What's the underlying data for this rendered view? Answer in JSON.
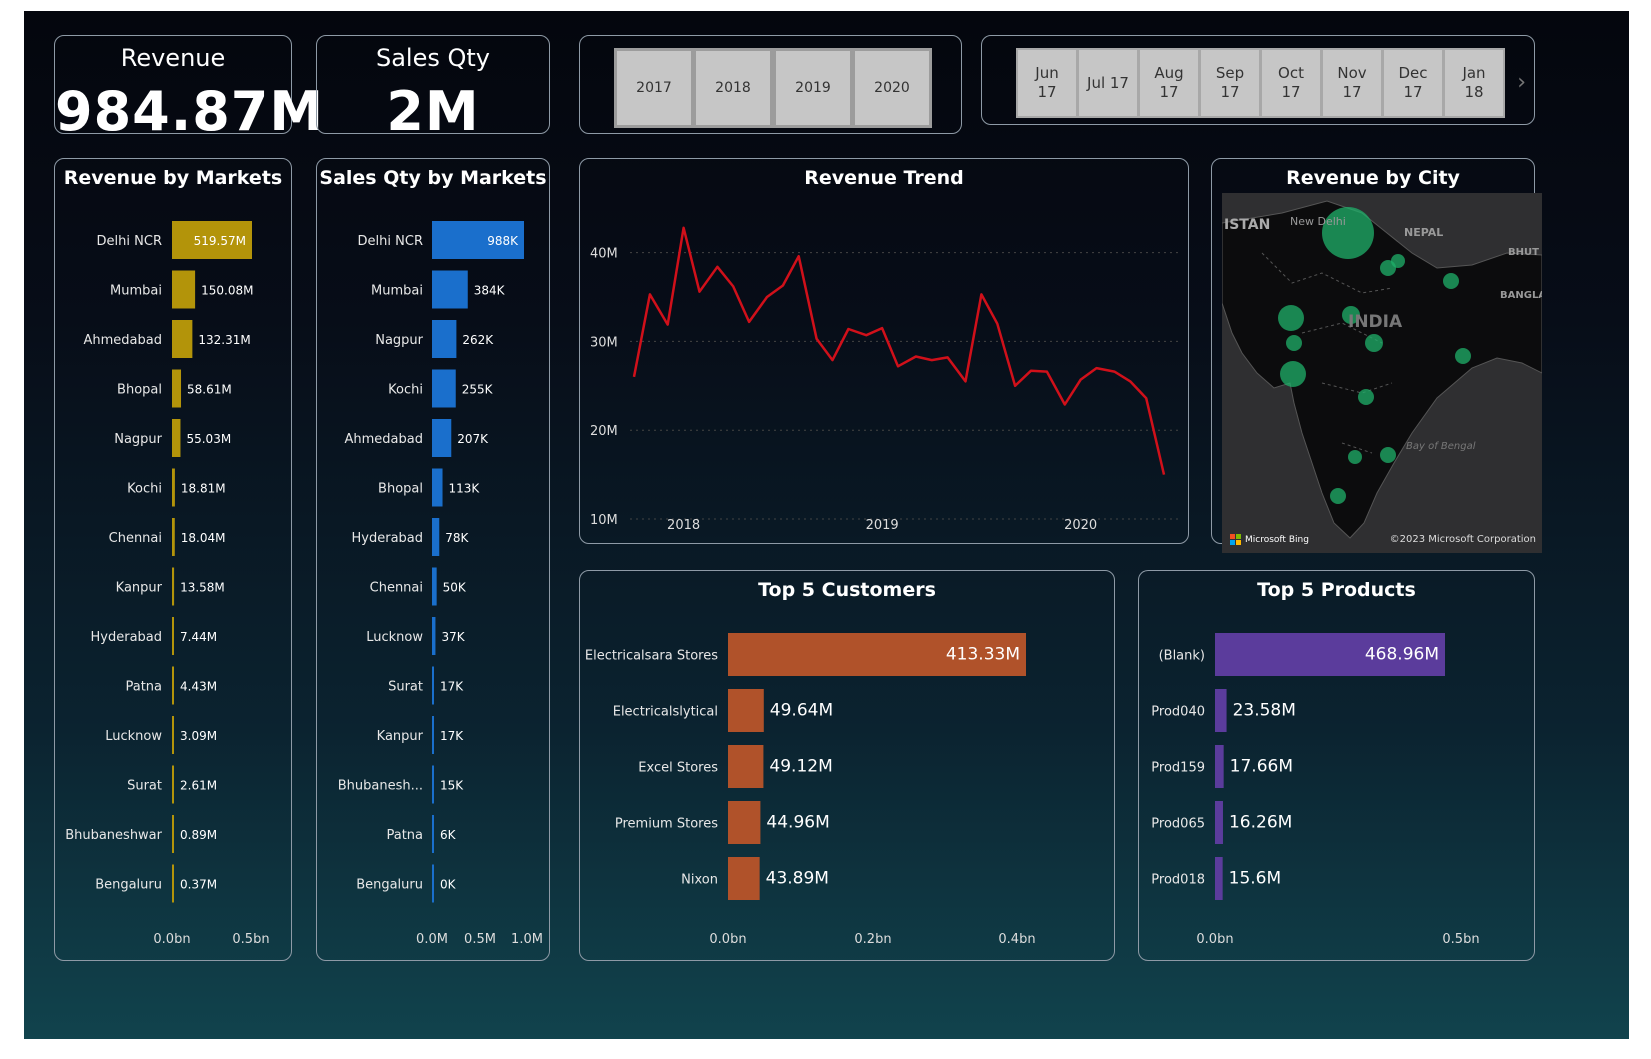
{
  "kpis": {
    "revenue": {
      "title": "Revenue",
      "value": "984.87M"
    },
    "sales_qty": {
      "title": "Sales Qty",
      "value": "2M"
    }
  },
  "years": [
    "2017",
    "2018",
    "2019",
    "2020"
  ],
  "months": [
    "Jun\n17",
    "Jul 17",
    "Aug\n17",
    "Sep\n17",
    "Oct\n17",
    "Nov\n17",
    "Dec\n17",
    "Jan\n18"
  ],
  "revenue_by_markets": {
    "title": "Revenue by Markets",
    "color": "#b3940a",
    "axis_ticks": [
      "0.0bn",
      "0.5bn"
    ],
    "items": [
      {
        "label": "Delhi NCR",
        "value": 519.57,
        "text": "519.57M"
      },
      {
        "label": "Mumbai",
        "value": 150.08,
        "text": "150.08M"
      },
      {
        "label": "Ahmedabad",
        "value": 132.31,
        "text": "132.31M"
      },
      {
        "label": "Bhopal",
        "value": 58.61,
        "text": "58.61M"
      },
      {
        "label": "Nagpur",
        "value": 55.03,
        "text": "55.03M"
      },
      {
        "label": "Kochi",
        "value": 18.81,
        "text": "18.81M"
      },
      {
        "label": "Chennai",
        "value": 18.04,
        "text": "18.04M"
      },
      {
        "label": "Kanpur",
        "value": 13.58,
        "text": "13.58M"
      },
      {
        "label": "Hyderabad",
        "value": 7.44,
        "text": "7.44M"
      },
      {
        "label": "Patna",
        "value": 4.43,
        "text": "4.43M"
      },
      {
        "label": "Lucknow",
        "value": 3.09,
        "text": "3.09M"
      },
      {
        "label": "Surat",
        "value": 2.61,
        "text": "2.61M"
      },
      {
        "label": "Bhubaneshwar",
        "value": 0.89,
        "text": "0.89M"
      },
      {
        "label": "Bengaluru",
        "value": 0.37,
        "text": "0.37M"
      }
    ]
  },
  "sales_qty_by_markets": {
    "title": "Sales Qty by Markets",
    "color": "#1a6fcc",
    "axis_ticks": [
      "0.0M",
      "0.5M",
      "1.0M"
    ],
    "items": [
      {
        "label": "Delhi NCR",
        "value": 988,
        "text": "988K"
      },
      {
        "label": "Mumbai",
        "value": 384,
        "text": "384K"
      },
      {
        "label": "Nagpur",
        "value": 262,
        "text": "262K"
      },
      {
        "label": "Kochi",
        "value": 255,
        "text": "255K"
      },
      {
        "label": "Ahmedabad",
        "value": 207,
        "text": "207K"
      },
      {
        "label": "Bhopal",
        "value": 113,
        "text": "113K"
      },
      {
        "label": "Hyderabad",
        "value": 78,
        "text": "78K"
      },
      {
        "label": "Chennai",
        "value": 50,
        "text": "50K"
      },
      {
        "label": "Lucknow",
        "value": 37,
        "text": "37K"
      },
      {
        "label": "Surat",
        "value": 17,
        "text": "17K"
      },
      {
        "label": "Kanpur",
        "value": 17,
        "text": "17K"
      },
      {
        "label": "Bhubanesh...",
        "value": 15,
        "text": "15K"
      },
      {
        "label": "Patna",
        "value": 6,
        "text": "6K"
      },
      {
        "label": "Bengaluru",
        "value": 0,
        "text": "0K"
      }
    ]
  },
  "revenue_trend": {
    "title": "Revenue Trend",
    "color": "#d0101a",
    "y_ticks": [
      {
        "v": 40,
        "label": "40M"
      },
      {
        "v": 30,
        "label": "30M"
      },
      {
        "v": 20,
        "label": "20M"
      },
      {
        "v": 10,
        "label": "10M"
      }
    ],
    "x_ticks": [
      {
        "v": 2018.0,
        "label": "2018"
      },
      {
        "v": 2019.0,
        "label": "2019"
      },
      {
        "v": 2020.0,
        "label": "2020"
      }
    ]
  },
  "chart_data": {
    "type": "line",
    "title": "Revenue Trend",
    "x": [
      2017.75,
      2017.83,
      2017.92,
      2018.0,
      2018.08,
      2018.17,
      2018.25,
      2018.33,
      2018.42,
      2018.5,
      2018.58,
      2018.67,
      2018.75,
      2018.83,
      2018.92,
      2019.0,
      2019.08,
      2019.17,
      2019.25,
      2019.33,
      2019.42,
      2019.5,
      2019.58,
      2019.67,
      2019.75,
      2019.83,
      2019.92,
      2020.0,
      2020.08,
      2020.17,
      2020.25,
      2020.33,
      2020.42
    ],
    "series": [
      {
        "values": [
          26.0,
          35.3,
          31.9,
          42.8,
          35.6,
          38.4,
          36.2,
          32.2,
          35.0,
          36.3,
          39.6,
          30.3,
          27.9,
          31.4,
          30.7,
          31.5,
          27.2,
          28.3,
          27.9,
          28.2,
          25.5,
          35.3,
          32.0,
          25.0,
          26.7,
          26.6,
          22.9,
          25.7,
          27.0,
          26.6,
          25.5,
          23.6,
          15.0
        ]
      }
    ],
    "ylim": [
      10,
      43
    ],
    "xlim": [
      2017.73,
      2020.45
    ],
    "grid": true
  },
  "revenue_by_city": {
    "title": "Revenue by City",
    "map_labels": [
      "ISTAN",
      "New Delhi",
      "NEPAL",
      "BHUT",
      "BANGLAI",
      "INDIA",
      "Bay of Bengal"
    ],
    "attribution": "Microsoft Bing",
    "copyright": "©2023 Microsoft Corporation",
    "bubble_color": "#1fb06a"
  },
  "top_customers": {
    "title": "Top 5 Customers",
    "color": "#b0522a",
    "axis_ticks": [
      "0.0bn",
      "0.2bn",
      "0.4bn"
    ],
    "items": [
      {
        "label": "Electricalsara Stores",
        "value": 413.33,
        "text": "413.33M"
      },
      {
        "label": "Electricalslytical",
        "value": 49.64,
        "text": "49.64M"
      },
      {
        "label": "Excel Stores",
        "value": 49.12,
        "text": "49.12M"
      },
      {
        "label": "Premium Stores",
        "value": 44.96,
        "text": "44.96M"
      },
      {
        "label": "Nixon",
        "value": 43.89,
        "text": "43.89M"
      }
    ]
  },
  "top_products": {
    "title": "Top 5 Products",
    "color": "#5b3c9c",
    "axis_ticks": [
      "0.0bn",
      "0.5bn"
    ],
    "items": [
      {
        "label": "(Blank)",
        "value": 468.96,
        "text": "468.96M"
      },
      {
        "label": "Prod040",
        "value": 23.58,
        "text": "23.58M"
      },
      {
        "label": "Prod159",
        "value": 17.66,
        "text": "17.66M"
      },
      {
        "label": "Prod065",
        "value": 16.26,
        "text": "16.26M"
      },
      {
        "label": "Prod018",
        "value": 15.6,
        "text": "15.6M"
      }
    ]
  }
}
